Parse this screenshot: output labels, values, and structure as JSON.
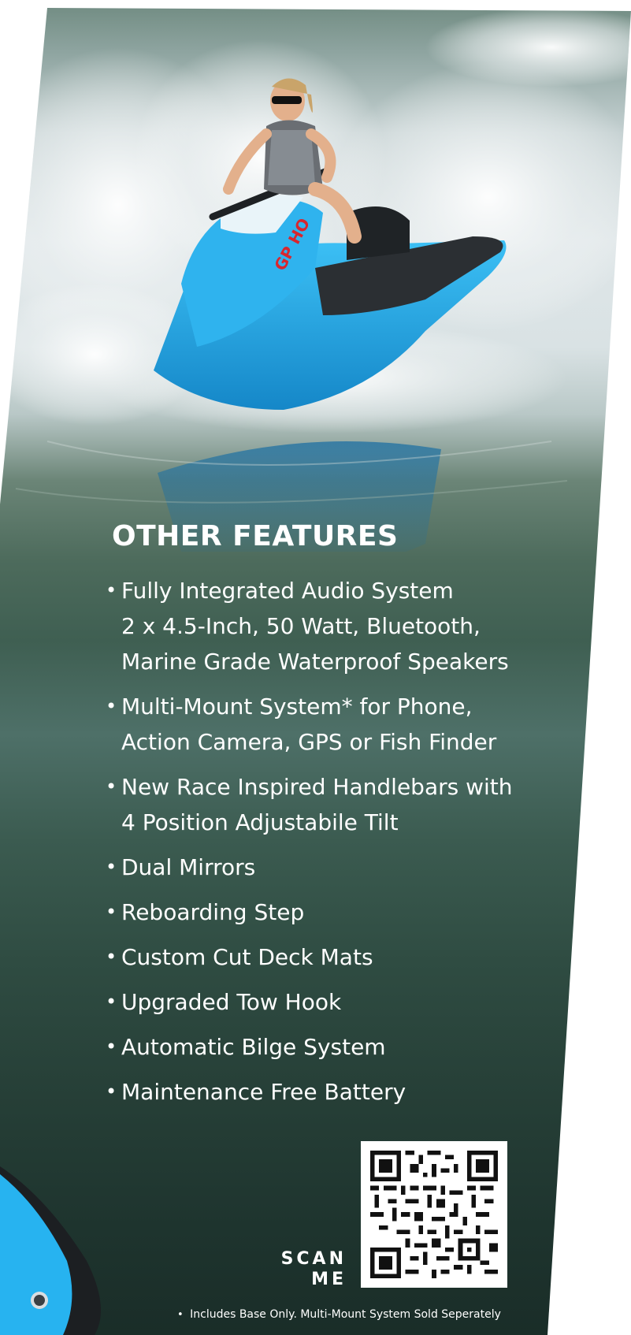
{
  "features": {
    "title": "OTHER FEATURES",
    "items": [
      {
        "lines": [
          "Fully Integrated Audio System",
          "2 x 4.5-Inch, 50 Watt, Bluetooth,",
          "Marine Grade Waterproof Speakers"
        ]
      },
      {
        "lines": [
          "Multi-Mount System* for Phone,",
          "Action Camera, GPS or Fish Finder"
        ]
      },
      {
        "lines": [
          "New Race Inspired Handlebars with",
          "4 Position Adjustabile Tilt"
        ]
      },
      {
        "lines": [
          "Dual Mirrors"
        ]
      },
      {
        "lines": [
          "Reboarding Step"
        ]
      },
      {
        "lines": [
          "Custom Cut Deck Mats"
        ]
      },
      {
        "lines": [
          "Upgraded Tow Hook"
        ]
      },
      {
        "lines": [
          "Automatic Bilge System"
        ]
      },
      {
        "lines": [
          "Maintenance Free Battery"
        ]
      }
    ],
    "bullet": "•"
  },
  "qr": {
    "scan_line1": "SCAN",
    "scan_line2": "ME"
  },
  "watercraft": {
    "badge_text": "GP HO"
  },
  "footnote": {
    "bullet": "•",
    "text": "Includes Base Only.  Multi-Mount System Sold Seperately"
  },
  "colors": {
    "craft_blue": "#1fa6e6",
    "text": "#ffffff",
    "water_dark": "#1e342e"
  }
}
